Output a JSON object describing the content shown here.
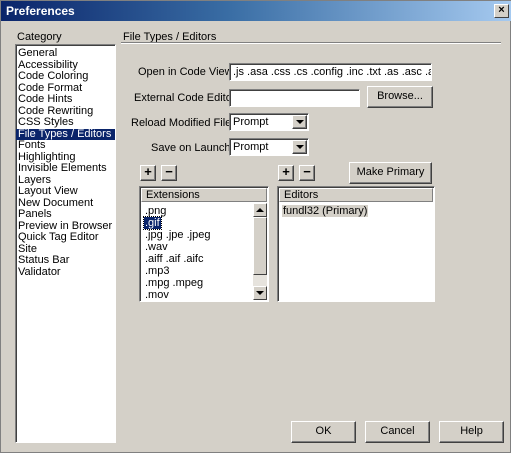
{
  "window": {
    "title": "Preferences",
    "close_glyph": "×"
  },
  "category": {
    "label": "Category",
    "items": [
      "General",
      "Accessibility",
      "Code Coloring",
      "Code Format",
      "Code Hints",
      "Code Rewriting",
      "CSS Styles",
      "File Types / Editors",
      "Fonts",
      "Highlighting",
      "Invisible Elements",
      "Layers",
      "Layout View",
      "New Document",
      "Panels",
      "Preview in Browser",
      "Quick Tag Editor",
      "Site",
      "Status Bar",
      "Validator"
    ],
    "selected_index": 7
  },
  "section_title": "File Types / Editors",
  "open_in_code_view": {
    "label": "Open in Code View:",
    "value": ".js .asa .css .cs .config .inc .txt .as .asc .asr"
  },
  "external_code_editor": {
    "label": "External Code Editor:",
    "value": "",
    "browse_label": "Browse..."
  },
  "reload_modified": {
    "label": "Reload Modified Files:",
    "value": "Prompt"
  },
  "save_on_launch": {
    "label": "Save on Launch:",
    "value": "Prompt"
  },
  "extensions": {
    "header": "Extensions",
    "items": [
      ".png",
      ".gif",
      ".jpg .jpe .jpeg",
      ".wav",
      ".aiff .aif .aifc",
      ".mp3",
      ".mpg .mpeg",
      ".mov"
    ],
    "selected_index": 1,
    "add_label": "+",
    "remove_label": "−"
  },
  "editors": {
    "header": "Editors",
    "items": [
      "fundl32 (Primary)"
    ],
    "add_label": "+",
    "remove_label": "−",
    "make_primary_label": "Make Primary"
  },
  "footer": {
    "ok_label": "OK",
    "cancel_label": "Cancel",
    "help_label": "Help"
  },
  "icons": {
    "dropdown": "chevron-down-icon",
    "scroll_up": "arrow-up-icon",
    "scroll_down": "arrow-down-icon"
  }
}
